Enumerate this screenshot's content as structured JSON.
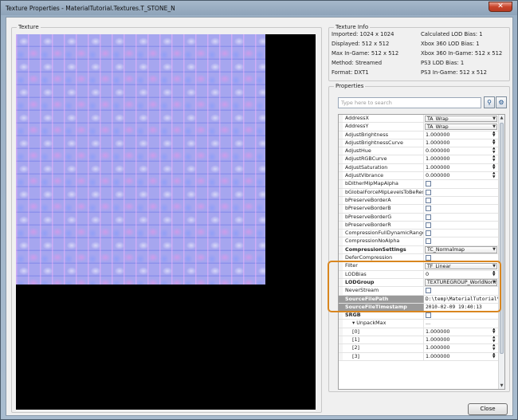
{
  "window": {
    "title": "Texture Properties - MaterialTutorial.Textures.T_STONE_N",
    "close_glyph": "✕"
  },
  "texture": {
    "label": "Texture"
  },
  "info": {
    "label": "Texture Info",
    "left": [
      "Imported: 1024 x 1024",
      "Displayed: 512 x 512",
      "Max In-Game: 512 x 512",
      "Method: Streamed",
      "Format: DXT1"
    ],
    "right": [
      "Calculated LOD Bias: 1",
      "Xbox 360 LOD Bias: 1",
      "Xbox 360 In-Game: 512 x 512",
      "PS3 LOD Bias: 1",
      "PS3 In-Game: 512 x 512"
    ]
  },
  "properties": {
    "label": "Properties",
    "search_placeholder": "Type here to search",
    "rows": [
      {
        "name": "AddressX",
        "value": "TA_Wrap",
        "kind": "combo"
      },
      {
        "name": "AddressY",
        "value": "TA_Wrap",
        "kind": "combo"
      },
      {
        "name": "AdjustBrightness",
        "value": "1.000000",
        "kind": "spin"
      },
      {
        "name": "AdjustBrightnessCurve",
        "value": "1.000000",
        "kind": "spin"
      },
      {
        "name": "AdjustHue",
        "value": "0.000000",
        "kind": "spin"
      },
      {
        "name": "AdjustRGBCurve",
        "value": "1.000000",
        "kind": "spin"
      },
      {
        "name": "AdjustSaturation",
        "value": "1.000000",
        "kind": "spin"
      },
      {
        "name": "AdjustVibrance",
        "value": "0.000000",
        "kind": "spin"
      },
      {
        "name": "bDitherMipMapAlpha",
        "value": "",
        "kind": "check"
      },
      {
        "name": "bGlobalForceMipLevelsToBeResid",
        "value": "",
        "kind": "check"
      },
      {
        "name": "bPreserveBorderA",
        "value": "",
        "kind": "check"
      },
      {
        "name": "bPreserveBorderB",
        "value": "",
        "kind": "check"
      },
      {
        "name": "bPreserveBorderG",
        "value": "",
        "kind": "check"
      },
      {
        "name": "bPreserveBorderR",
        "value": "",
        "kind": "check"
      },
      {
        "name": "CompressionFullDynamicRange",
        "value": "",
        "kind": "check"
      },
      {
        "name": "CompressionNoAlpha",
        "value": "",
        "kind": "check"
      },
      {
        "name": "CompressionSettings",
        "value": "TC_Normalmap",
        "kind": "combo",
        "bold": true
      },
      {
        "name": "DeferCompression",
        "value": "",
        "kind": "check"
      },
      {
        "name": "Filter",
        "value": "TF_Linear",
        "kind": "combo"
      },
      {
        "name": "LODBias",
        "value": "0",
        "kind": "spin"
      },
      {
        "name": "LODGroup",
        "value": "TEXTUREGROUP_WorldNorm",
        "kind": "combo",
        "bold": true
      },
      {
        "name": "NeverStream",
        "value": "",
        "kind": "check"
      },
      {
        "name": "SourceFilePath",
        "value": "D:\\temp\\MaterialTutorial\\T",
        "kind": "gray"
      },
      {
        "name": "SourceFileTimestamp",
        "value": "2010-02-09 19:40:13",
        "kind": "gray"
      },
      {
        "name": "SRGB",
        "value": "",
        "kind": "check",
        "cat": true
      },
      {
        "name": "▾ UnpackMax",
        "value": "...",
        "kind": "text",
        "sub": true
      },
      {
        "name": "[0]",
        "value": "1.000000",
        "kind": "spin",
        "child": true
      },
      {
        "name": "[1]",
        "value": "1.000000",
        "kind": "spin",
        "child": true
      },
      {
        "name": "[2]",
        "value": "1.000000",
        "kind": "spin",
        "child": true
      },
      {
        "name": "[3]",
        "value": "1.000000",
        "kind": "spin",
        "child": true
      }
    ]
  },
  "close_button": "Close",
  "colors": {
    "highlight": "#d9861f",
    "header_gray": "#9a9a9a"
  },
  "icons": {
    "search": "search-icon",
    "filter": "search-options-icon"
  }
}
